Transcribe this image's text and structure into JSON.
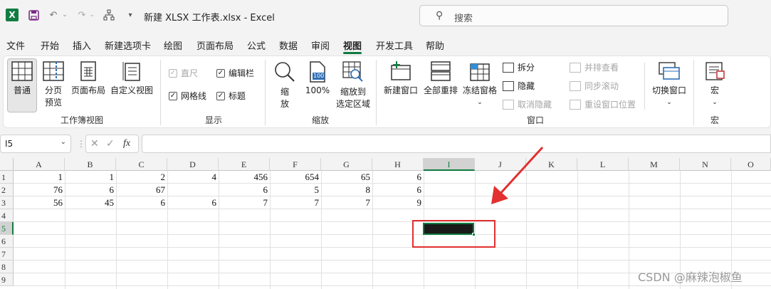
{
  "titlebar": {
    "title": "新建 XLSX 工作表.xlsx  -  Excel",
    "search_placeholder": "搜索",
    "logo_letter": "X"
  },
  "menu": {
    "tabs": [
      "文件",
      "开始",
      "插入",
      "新建选项卡",
      "绘图",
      "页面布局",
      "公式",
      "数据",
      "审阅",
      "视图",
      "开发工具",
      "帮助"
    ],
    "active_tab": "视图"
  },
  "ribbon": {
    "workbook_views": {
      "group_label": "工作簿视图",
      "normal": "普通",
      "page_break_line1": "分页",
      "page_break_line2": "预览",
      "page_layout": "页面布局",
      "custom_views": "自定义视图"
    },
    "show": {
      "group_label": "显示",
      "ruler": "直尺",
      "formula_bar": "编辑栏",
      "gridlines": "网格线",
      "headings": "标题"
    },
    "zoom": {
      "group_label": "缩放",
      "zoom_line1": "缩",
      "zoom_line2": "放",
      "zoom_100": "100%",
      "zoom_selection_line1": "缩放到",
      "zoom_selection_line2": "选定区域",
      "zoom_100_icon_text": "100"
    },
    "window": {
      "group_label": "窗口",
      "new_window": "新建窗口",
      "arrange_all": "全部重排",
      "freeze_panes": "冻结窗格",
      "split": "拆分",
      "hide": "隐藏",
      "unhide": "取消隐藏",
      "view_side_by_side": "并排查看",
      "sync_scrolling": "同步滚动",
      "reset_position": "重设窗口位置",
      "switch_windows": "切换窗口"
    },
    "macros": {
      "group_label": "宏",
      "macros": "宏"
    }
  },
  "formula_bar": {
    "name_box": "I5",
    "fx": "fx",
    "value": ""
  },
  "sheet": {
    "columns": [
      "A",
      "B",
      "C",
      "D",
      "E",
      "F",
      "G",
      "H",
      "I",
      "J",
      "K",
      "L",
      "M",
      "N",
      "O"
    ],
    "selected_column": "I",
    "rows": [
      "1",
      "2",
      "3",
      "4",
      "5",
      "6",
      "7",
      "8",
      "9"
    ],
    "selected_row": "5",
    "cells": [
      [
        "1",
        "1",
        "2",
        "4",
        "456",
        "654",
        "65",
        "6"
      ],
      [
        "76",
        "6",
        "67",
        "",
        "6",
        "5",
        "8",
        "6"
      ],
      [
        "56",
        "45",
        "6",
        "6",
        "7",
        "7",
        "7",
        "9"
      ]
    ],
    "active_cell": "I5"
  },
  "watermark": "CSDN @麻辣泡椒鱼",
  "colors": {
    "excel_green": "#107c41",
    "annotation_red": "#e23030"
  }
}
